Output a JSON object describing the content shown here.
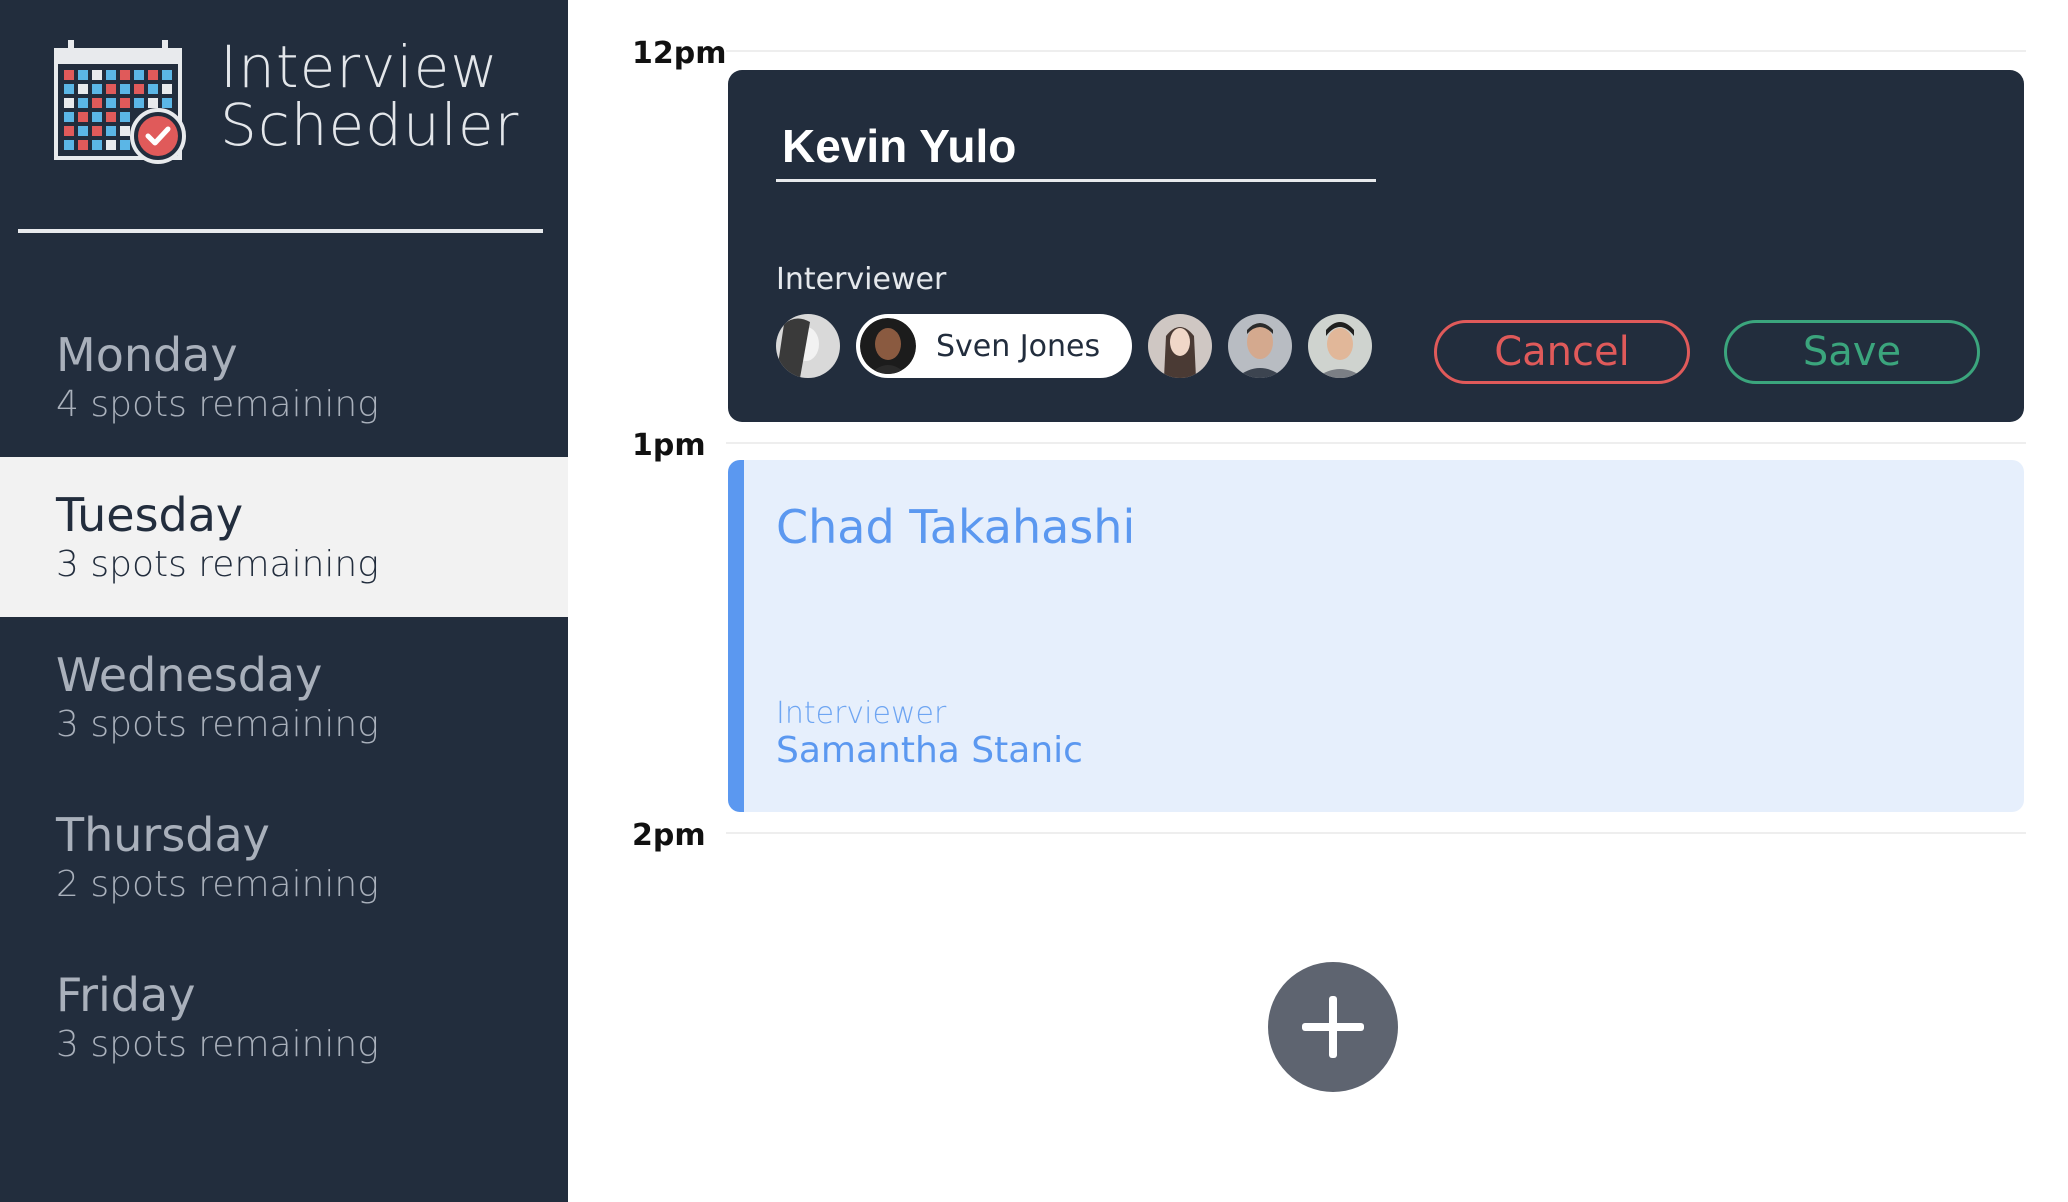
{
  "app": {
    "title_line1": "Interview",
    "title_line2": "Scheduler",
    "logo": "calendar-check-icon"
  },
  "sidebar": {
    "days": [
      {
        "name": "Monday",
        "spots": "4 spots remaining",
        "selected": false
      },
      {
        "name": "Tuesday",
        "spots": "3 spots remaining",
        "selected": true
      },
      {
        "name": "Wednesday",
        "spots": "3 spots remaining",
        "selected": false
      },
      {
        "name": "Thursday",
        "spots": "2 spots remaining",
        "selected": false
      },
      {
        "name": "Friday",
        "spots": "3 spots remaining",
        "selected": false
      }
    ]
  },
  "schedule": {
    "times": [
      "12pm",
      "1pm",
      "2pm"
    ],
    "editing": {
      "student_value": "Kevin Yulo",
      "interviewer_label": "Interviewer",
      "selected_interviewer": "Sven Jones",
      "cancel_label": "Cancel",
      "save_label": "Save"
    },
    "booked": {
      "student": "Chad Takahashi",
      "interviewer_label": "Interviewer",
      "interviewer": "Samantha Stanic"
    },
    "add_icon": "plus-icon"
  },
  "colors": {
    "sidebar_bg": "#222d3d",
    "selected_day_bg": "#f2f2f2",
    "cancel": "#e05a5a",
    "save": "#3ba57d",
    "booked_accent": "#5b98f0",
    "booked_bg": "#e6effc",
    "add_button": "#5e6470"
  }
}
